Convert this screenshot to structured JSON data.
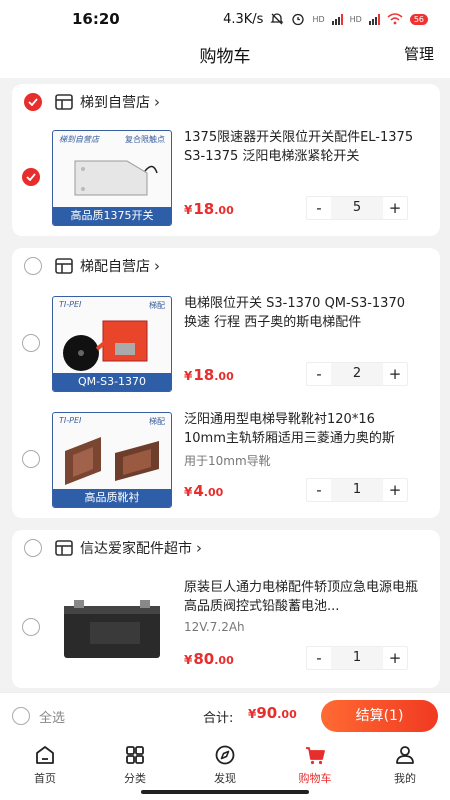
{
  "status_bar": {
    "time": "16:20",
    "network_speed": "4.3K/s",
    "signal_1": "HD",
    "signal_2": "HD",
    "battery": "56"
  },
  "header": {
    "title": "购物车",
    "manage": "管理"
  },
  "stores": [
    {
      "name": "梯到自营店",
      "checked": true,
      "items": [
        {
          "title": "1375限速器开关限位开关配件EL-1375 S3-1375 泛阳电梯涨紧轮开关",
          "spec": "",
          "price_symbol": "¥",
          "price_int": "18",
          "price_dec": ".00",
          "qty": "5",
          "checked": true,
          "thumb_caption": "高品质1375开关",
          "thumb_brand": "梯到自营店",
          "thumb_brand2": "复合限触点"
        }
      ]
    },
    {
      "name": "梯配自营店",
      "checked": false,
      "items": [
        {
          "title": "电梯限位开关 S3-1370 QM-S3-1370 换速 行程 西子奥的斯电梯配件",
          "spec": "",
          "price_symbol": "¥",
          "price_int": "18",
          "price_dec": ".00",
          "qty": "2",
          "checked": false,
          "thumb_caption": "QM-S3-1370",
          "thumb_brand": "TI-PEI",
          "thumb_brand2": "梯配"
        },
        {
          "title": "泛阳通用型电梯导靴靴衬120*16 10mm主轨轿厢适用三菱通力奥的斯",
          "spec": "用于10mm导靴",
          "price_symbol": "¥",
          "price_int": "4",
          "price_dec": ".00",
          "qty": "1",
          "checked": false,
          "thumb_caption": "高品质靴衬",
          "thumb_brand": "TI-PEI",
          "thumb_brand2": "梯配"
        }
      ]
    },
    {
      "name": "信达爱家配件超市",
      "checked": false,
      "items": [
        {
          "title": "原装巨人通力电梯配件轿顶应急电源电瓶 高品质阀控式铅酸蓄电池...",
          "spec": "12V.7.2Ah",
          "price_symbol": "¥",
          "price_int": "80",
          "price_dec": ".00",
          "qty": "1",
          "checked": false
        }
      ]
    }
  ],
  "stepper": {
    "minus": "-",
    "plus": "+"
  },
  "footer": {
    "select_all": "全选",
    "total_label": "合计:",
    "total_symbol": "¥",
    "total_int": "90",
    "total_dec": ".00",
    "checkout": "结算(1)"
  },
  "tabs": [
    {
      "label": "首页",
      "icon": "home-icon"
    },
    {
      "label": "分类",
      "icon": "category-grid-icon"
    },
    {
      "label": "发现",
      "icon": "compass-icon"
    },
    {
      "label": "购物车",
      "icon": "cart-icon",
      "active": true
    },
    {
      "label": "我的",
      "icon": "profile-icon"
    }
  ],
  "colors": {
    "accent": "#e82d2d",
    "checkout_start": "#ff6a33",
    "checkout_end": "#f03a21"
  }
}
